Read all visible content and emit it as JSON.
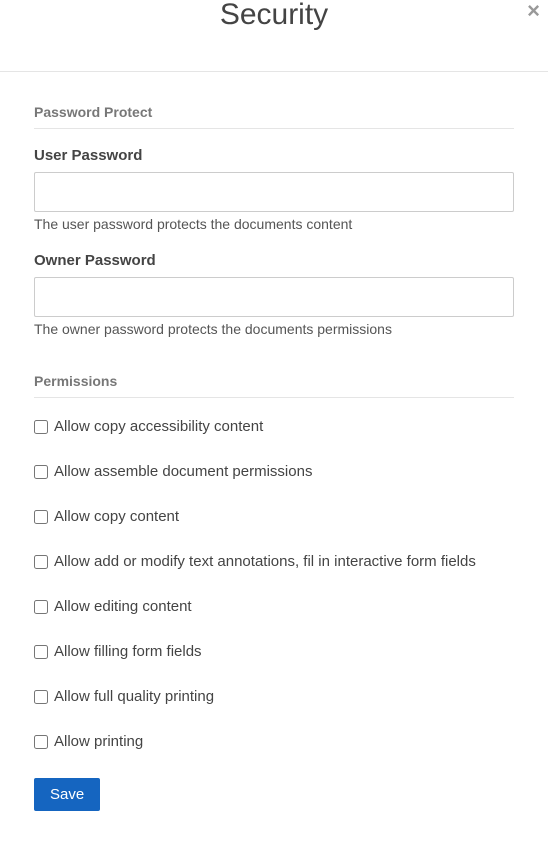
{
  "modal": {
    "title": "Security",
    "close_symbol": "×"
  },
  "password_section": {
    "heading": "Password Protect",
    "user_password": {
      "label": "User Password",
      "value": "",
      "help": "The user password protects the documents content"
    },
    "owner_password": {
      "label": "Owner Password",
      "value": "",
      "help": "The owner password protects the documents permissions"
    }
  },
  "permissions_section": {
    "heading": "Permissions",
    "items": [
      {
        "label": "Allow copy accessibility content",
        "checked": false
      },
      {
        "label": "Allow assemble document permissions",
        "checked": false
      },
      {
        "label": "Allow copy content",
        "checked": false
      },
      {
        "label": "Allow add or modify text annotations, fil in interactive form fields",
        "checked": false
      },
      {
        "label": "Allow editing content",
        "checked": false
      },
      {
        "label": "Allow filling form fields",
        "checked": false
      },
      {
        "label": "Allow full quality printing",
        "checked": false
      },
      {
        "label": "Allow printing",
        "checked": false
      }
    ]
  },
  "actions": {
    "save_label": "Save"
  }
}
